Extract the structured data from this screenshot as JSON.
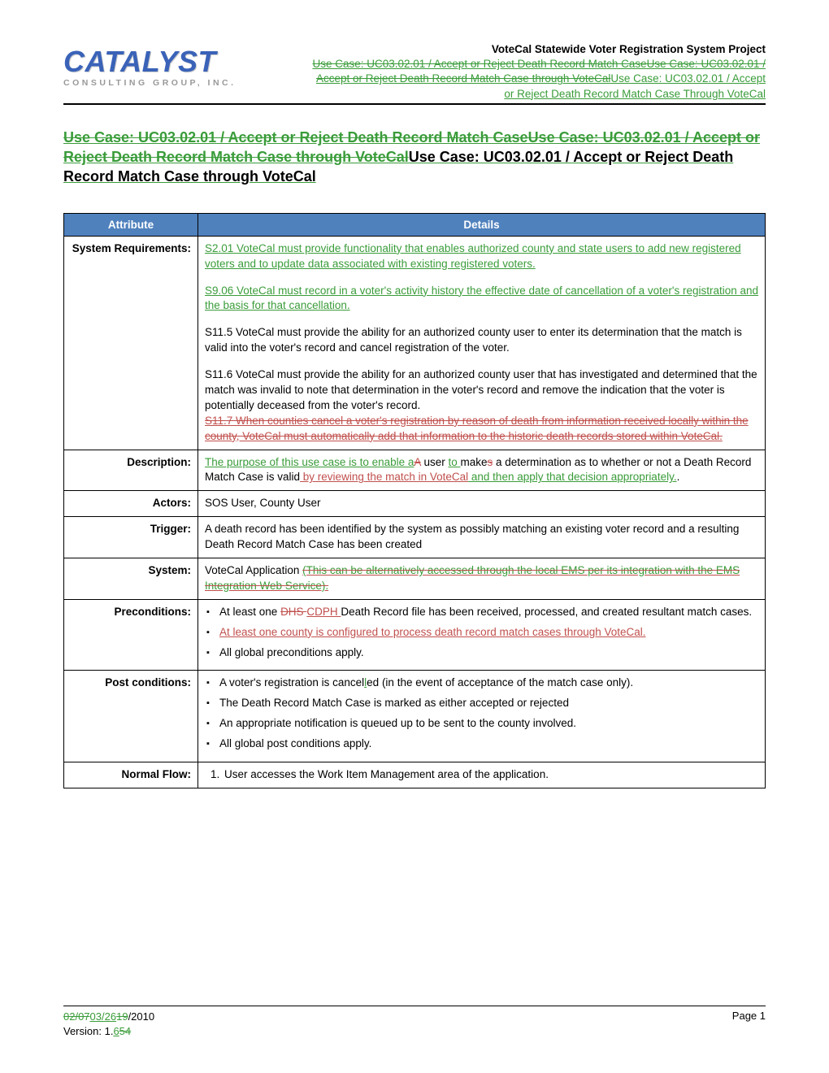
{
  "logo": {
    "main": "CATALYST",
    "sub": "CONSULTING GROUP, INC."
  },
  "header": {
    "project_title": "VoteCal Statewide Voter Registration System Project",
    "uc": {
      "seg1": "Use Case: UC03.02.01 / Accept or Reject Death Record Match Case",
      "seg2": "Use Case: UC03.02.01 / Accept or Reject Death Record Match Case through VoteCal",
      "seg3": "Use Case: UC03.02.01 / Accept or Reject Death Record Match Case Through VoteCal"
    }
  },
  "heading": {
    "seg1": "Use Case: UC03.02.01 / Accept or Reject Death Record Match Case",
    "seg2": "Use Case: UC03.02.01 / Accept or Reject Death Record Match Case through VoteCal",
    "seg3": "Use Case: UC03.02.01 / Accept or Reject Death Record Match Case through VoteCal"
  },
  "table": {
    "headers": {
      "attr": "Attribute",
      "det": "Details"
    },
    "rows": {
      "sysreq": {
        "label": "System Requirements:",
        "p1": "S2.01 VoteCal must provide functionality that enables authorized county and state users to add new registered voters and to update data associated with existing registered voters.",
        "p2": "S9.06 VoteCal must record in a voter's activity history the effective date of cancellation of a voter's registration and the basis for that cancellation.",
        "p3": "S11.5 VoteCal must provide the ability for an authorized county user to enter its determination that the match is valid into the voter's record and cancel registration of the voter.",
        "p4": "S11.6 VoteCal must provide the ability for an authorized county user that has investigated and determined that the match was invalid to note that determination in the voter's record and remove the indication that the voter is potentially deceased from the voter's record.",
        "p5": "S11.7 When counties cancel a voter's registration by reason of death from information received locally within the county, VoteCal must automatically add that information to the historic death records stored within VoteCal."
      },
      "desc": {
        "label": "Description:",
        "parts": {
          "a": "The purpose of this use case is to enable a",
          "b": "A",
          "c": " user ",
          "d": "to ",
          "e": "make",
          "f": "s",
          "g": " a determination as to whether or not a Death Record Match Case is valid",
          "h": " by reviewing the match in VoteCal",
          "i": " and then apply that decision appropriately.",
          "j": "."
        }
      },
      "actors": {
        "label": "Actors:",
        "text": "SOS User, County User"
      },
      "trigger": {
        "label": "Trigger:",
        "text": "A death record has been identified by the system as possibly matching an existing voter record and a resulting Death Record Match Case has been created"
      },
      "system": {
        "label": "System:",
        "a": "VoteCal Application ",
        "b": "(This can be alternatively accessed through the local EMS per its integration with the EMS Integration Web Service)."
      },
      "precond": {
        "label": "Preconditions:",
        "li1": {
          "a": "At least one ",
          "b": "DHS ",
          "c": "CDPH ",
          "d": "Death Record file has been received, processed, and created resultant match cases."
        },
        "li2": "At least one county is configured to process death record match cases through VoteCal.",
        "li3": "All global preconditions apply."
      },
      "postcond": {
        "label": "Post conditions:",
        "li1": {
          "a": "A voter's registration is cancel",
          "b": "l",
          "c": "ed (in the event of acceptance of the match case only)."
        },
        "li2": "The Death Record Match Case is marked as either accepted or rejected",
        "li3": "An appropriate notification is queued up to be sent to the county involved.",
        "li4": "All global post conditions apply."
      },
      "normal": {
        "label": "Normal Flow:",
        "li1": "User accesses the Work Item Management area of the application."
      }
    }
  },
  "footer": {
    "date": {
      "a": "02/07",
      "b": "03/26",
      "c": "19",
      "d": "/2010"
    },
    "version": {
      "a": "Version: 1.",
      "b": "6",
      "c": "5",
      "d": "4"
    },
    "page": "Page 1"
  }
}
